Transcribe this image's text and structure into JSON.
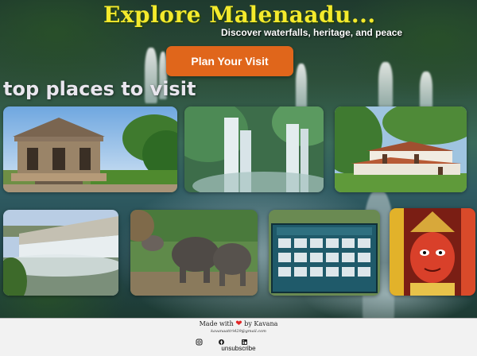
{
  "hero": {
    "title": "Explore Malenaadu...",
    "subtitle": "Discover waterfalls, heritage, and peace",
    "cta_label": "Plan Your Visit"
  },
  "section": {
    "heading": "top places to visit"
  },
  "gallery": [
    {
      "subject": "stone temple"
    },
    {
      "subject": "waterfalls"
    },
    {
      "subject": "heritage house"
    },
    {
      "subject": "dam"
    },
    {
      "subject": "elephant camp"
    },
    {
      "subject": "bird sign board"
    },
    {
      "subject": "deity idol"
    }
  ],
  "footer": {
    "made_prefix": "Made with",
    "made_suffix": "by Kavana",
    "email": "kavanaattri429@gmail.com",
    "unsubscribe": "unsubscribe",
    "icons": [
      "instagram-icon",
      "facebook-icon",
      "linkedin-icon"
    ]
  },
  "colors": {
    "title": "#f4ea2c",
    "cta": "#e0661b",
    "heart": "#e32626",
    "footer_bg": "#f2f2f2"
  }
}
